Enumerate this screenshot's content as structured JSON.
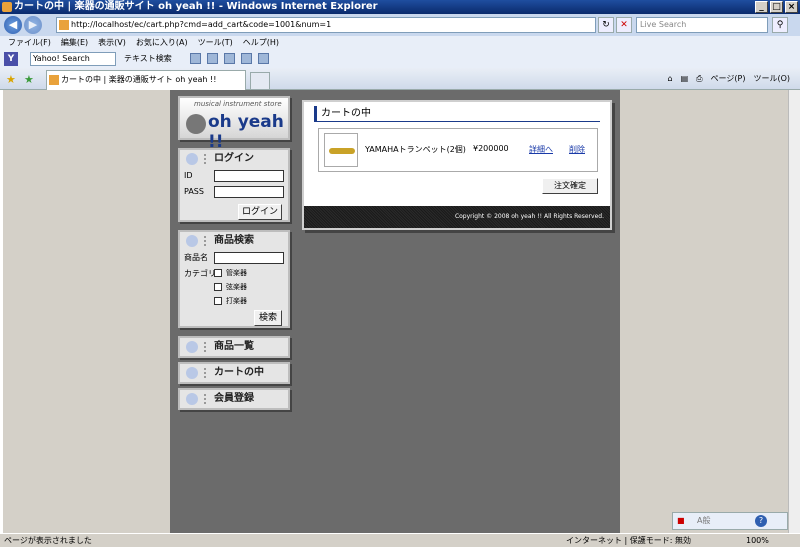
{
  "window": {
    "title": "カートの中 | 楽器の通販サイト oh yeah !! - Windows Internet Explorer",
    "controls": [
      "_",
      "□",
      "×"
    ]
  },
  "address_bar": {
    "url": "http://localhost/ec/cart.php?cmd=add_cart&code=1001&num=1",
    "search_placeholder": "Live Search"
  },
  "menu": [
    "ファイル(F)",
    "編集(E)",
    "表示(V)",
    "お気に入り(A)",
    "ツール(T)",
    "ヘルプ(H)"
  ],
  "yahoo_toolbar": {
    "search_value": "Yahoo! Search",
    "text_search_label": "テキスト検索"
  },
  "tabs": {
    "active_label": "カートの中 | 楽器の通販サイト oh yeah !!",
    "command_bar": [
      "ページ(P)",
      "ツール(O)"
    ]
  },
  "site": {
    "logo_tagline": "musical instrument store",
    "logo_name": "oh yeah !!"
  },
  "login": {
    "title": "ログイン",
    "id_label": "ID",
    "pass_label": "PASS",
    "button": "ログイン"
  },
  "product_search": {
    "title": "商品検索",
    "name_label": "商品名",
    "category_label": "カテゴリ",
    "categories": [
      "管楽器",
      "弦楽器",
      "打楽器"
    ],
    "button": "検索"
  },
  "nav": {
    "products": "商品一覧",
    "cart": "カートの中",
    "register": "会員登録"
  },
  "cart": {
    "title": "カートの中",
    "item": {
      "name": "YAMAHAトランペット(2個)",
      "price": "¥200000",
      "detail_link": "詳細へ",
      "delete_link": "削除"
    },
    "checkout_button": "注文確定",
    "copyright": "Copyright © 2008 oh yeah !! All Rights Reserved."
  },
  "status": {
    "text": "ページが表示されました",
    "zone": "インターネット | 保護モード: 無効",
    "zoom": "100%"
  },
  "ime": {
    "mode": "A般"
  }
}
